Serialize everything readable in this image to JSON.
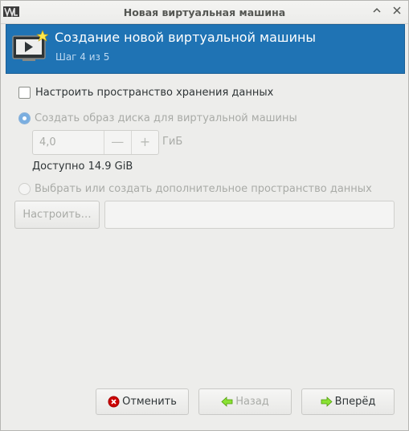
{
  "window": {
    "title": "Новая виртуальная машина",
    "app_icon": "virt-manager-icon",
    "maximize_glyph": "∧",
    "close_glyph": "✕"
  },
  "banner": {
    "title": "Создание новой виртуальной машины",
    "subtitle": "Шаг 4 из 5",
    "icon": "new-vm-monitor-icon",
    "bg_color": "#1f73b4"
  },
  "storage": {
    "enable_label": "Настроить пространство хранения данных",
    "enable_checked": false,
    "create_disk_label": "Создать образ диска для виртуальной машины",
    "create_disk_selected": true,
    "size_value": "4,0",
    "minus_glyph": "—",
    "plus_glyph": "+",
    "size_unit": "ГиБ",
    "available": "Доступно 14.9 GiB",
    "select_custom_label": "Выбрать или создать дополнительное пространство данных",
    "select_custom_selected": false,
    "browse_label": "Настроить…",
    "path_value": ""
  },
  "footer": {
    "cancel_label": "Отменить",
    "back_label": "Назад",
    "forward_label": "Вперёд"
  }
}
